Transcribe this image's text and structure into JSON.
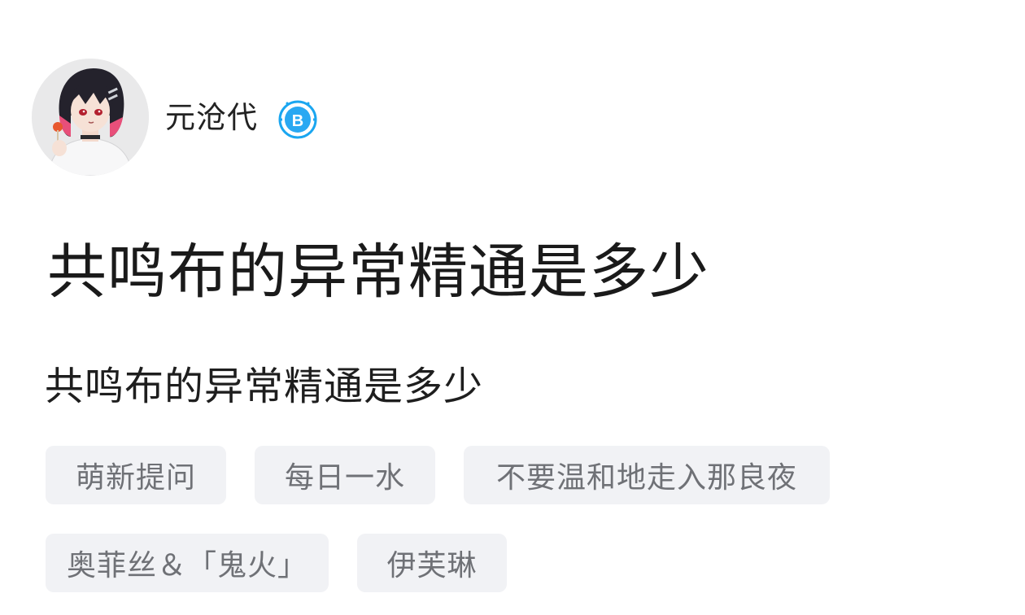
{
  "author": {
    "name": "元沧代",
    "badge_icon": "bilibili-verified-icon",
    "badge_color": "#1aa6f0"
  },
  "post": {
    "title": "共鸣布的异常精通是多少",
    "body": "共鸣布的异常精通是多少"
  },
  "tags": [
    {
      "label": "萌新提问"
    },
    {
      "label": "每日一水"
    },
    {
      "label": "不要温和地走入那良夜"
    },
    {
      "label": "奥菲丝＆「鬼火」"
    },
    {
      "label": "伊芙琳"
    }
  ],
  "colors": {
    "tag_bg": "#f1f2f5",
    "tag_text": "#6f7176",
    "title_text": "#1a1a1a"
  }
}
